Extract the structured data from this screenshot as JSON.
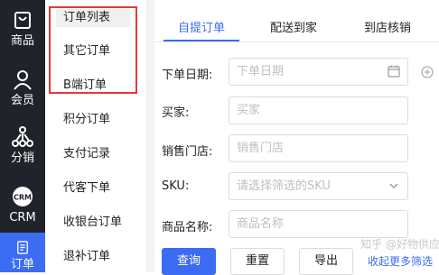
{
  "rail": {
    "items": [
      {
        "label": "商品",
        "icon": "bag-icon"
      },
      {
        "label": "会员",
        "icon": "user-icon"
      },
      {
        "label": "分销",
        "icon": "network-icon"
      },
      {
        "label": "CRM",
        "icon": "crm-icon"
      },
      {
        "label": "订单",
        "icon": "document-icon"
      }
    ]
  },
  "submenu": {
    "items": [
      {
        "label": "订单列表"
      },
      {
        "label": "其它订单"
      },
      {
        "label": "B端订单"
      },
      {
        "label": "积分订单"
      },
      {
        "label": "支付记录"
      },
      {
        "label": "代客下单"
      },
      {
        "label": "收银台订单"
      },
      {
        "label": "退补订单"
      }
    ]
  },
  "tabs": [
    {
      "label": "自提订单"
    },
    {
      "label": "配送到家"
    },
    {
      "label": "到店核销"
    }
  ],
  "form": {
    "order_date": {
      "label": "下单日期:",
      "placeholder": "下单日期"
    },
    "buyer": {
      "label": "买家:",
      "placeholder": "买家"
    },
    "store": {
      "label": "销售门店:",
      "placeholder": "销售门店"
    },
    "sku": {
      "label": "SKU:",
      "placeholder": "请选择筛选的SKU"
    },
    "product_name": {
      "label": "商品名称:",
      "placeholder": "商品名称"
    }
  },
  "actions": {
    "query": "查询",
    "reset": "重置",
    "export": "导出",
    "collapse_more": "收起更多筛选"
  },
  "watermark": "知乎 @好物供应链",
  "colors": {
    "accent": "#3b6cf2",
    "rail_bg": "#20232a",
    "highlight_box": "#e53935"
  }
}
